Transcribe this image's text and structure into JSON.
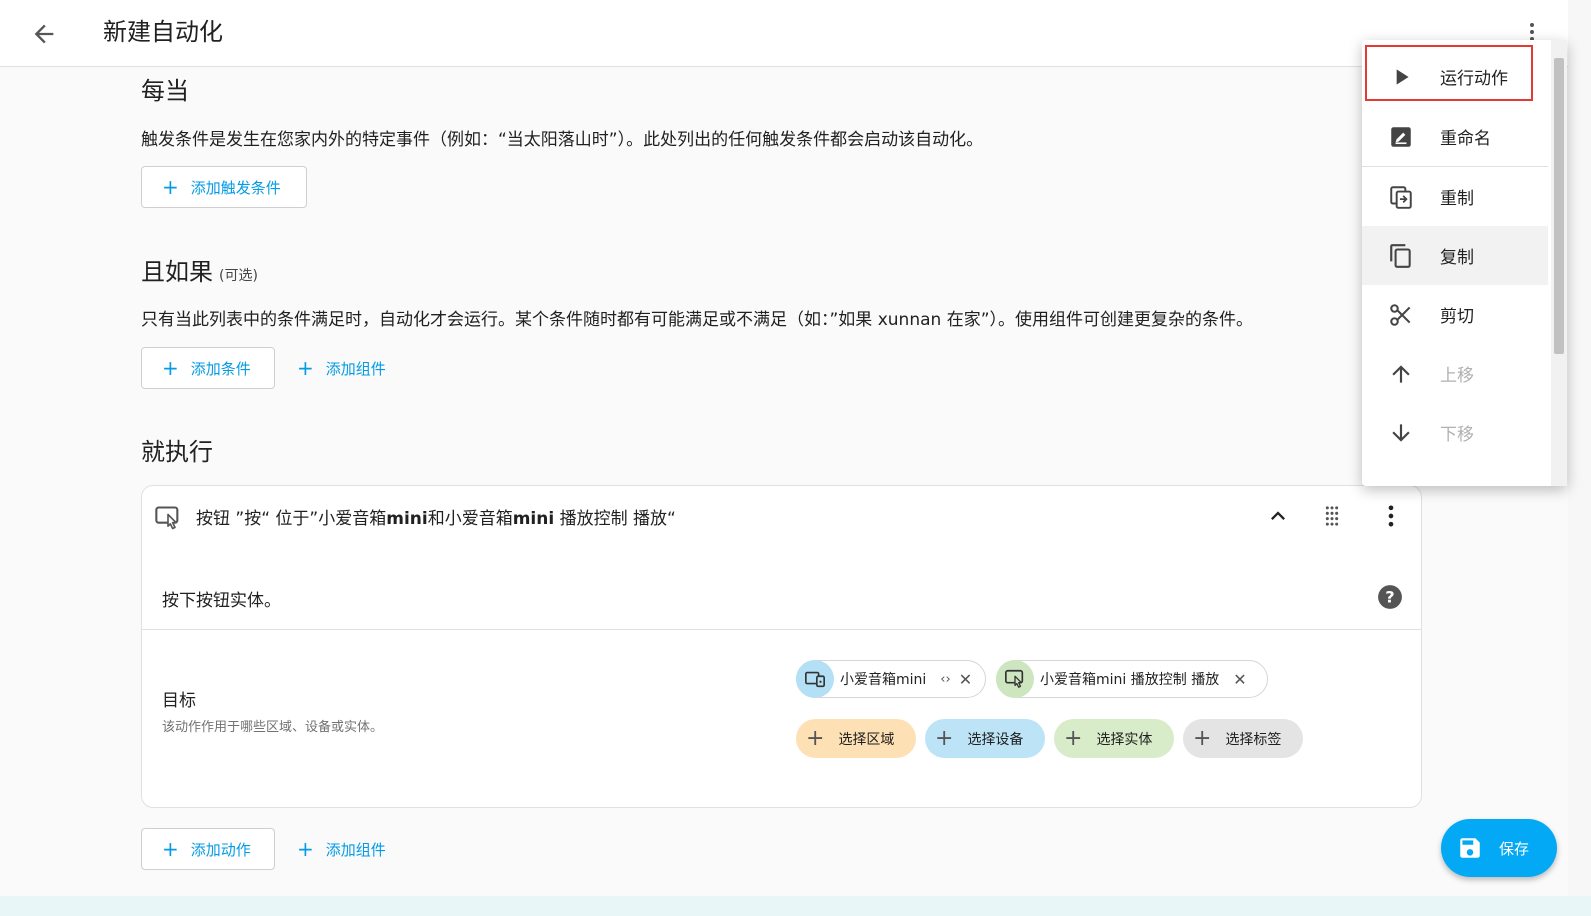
{
  "header": {
    "title": "新建自动化"
  },
  "triggers": {
    "title": "每当",
    "description": "触发条件是发生在您家内外的特定事件（例如：“当太阳落山时”）。此处列出的任何触发条件都会启动该自动化。",
    "add_trigger": "添加触发条件"
  },
  "conditions": {
    "title": "且如果",
    "optional": "(可选)",
    "description": "只有当此列表中的条件满足时，自动化才会运行。某个条件随时都有可能满足或不满足（如：”如果 xunnan 在家”）。使用组件可创建更复杂的条件。",
    "add_condition": "添加条件",
    "add_building_block": "添加组件"
  },
  "actions": {
    "title": "就执行",
    "card": {
      "title_prefix": "按钮 ”按“ 位于”小爱音箱",
      "title_bold1": "mini",
      "title_mid": "和小爱音箱",
      "title_bold2": "mini",
      "title_suffix": " 播放控制 播放“",
      "description": "按下按钮实体。",
      "target_label": "目标",
      "target_help": "该动作作用于哪些区域、设备或实体。",
      "chips": [
        {
          "label": "小爱音箱mini",
          "icon": "device-icon",
          "color": "#b3e0f5"
        },
        {
          "label": "小爱音箱mini 播放控制 播放",
          "icon": "button-entity-icon",
          "color": "#cde6c0"
        }
      ],
      "pickers": [
        {
          "label": "选择区域",
          "color": "#fde0b3"
        },
        {
          "label": "选择设备",
          "color": "#bde3f7"
        },
        {
          "label": "选择实体",
          "color": "#d8ecc9"
        },
        {
          "label": "选择标签",
          "color": "#e4e4e4"
        }
      ]
    },
    "add_action": "添加动作",
    "add_building_block": "添加组件"
  },
  "save_label": "保存",
  "menu": {
    "items": [
      {
        "label": "运行动作",
        "icon": "play-icon"
      },
      {
        "label": "重命名",
        "icon": "rename-icon"
      },
      {
        "label": "重制",
        "icon": "duplicate-icon"
      },
      {
        "label": "复制",
        "icon": "copy-icon"
      },
      {
        "label": "剪切",
        "icon": "cut-icon"
      },
      {
        "label": "上移",
        "icon": "arrow-up-icon",
        "disabled": true
      },
      {
        "label": "下移",
        "icon": "arrow-down-icon",
        "disabled": true
      }
    ]
  }
}
